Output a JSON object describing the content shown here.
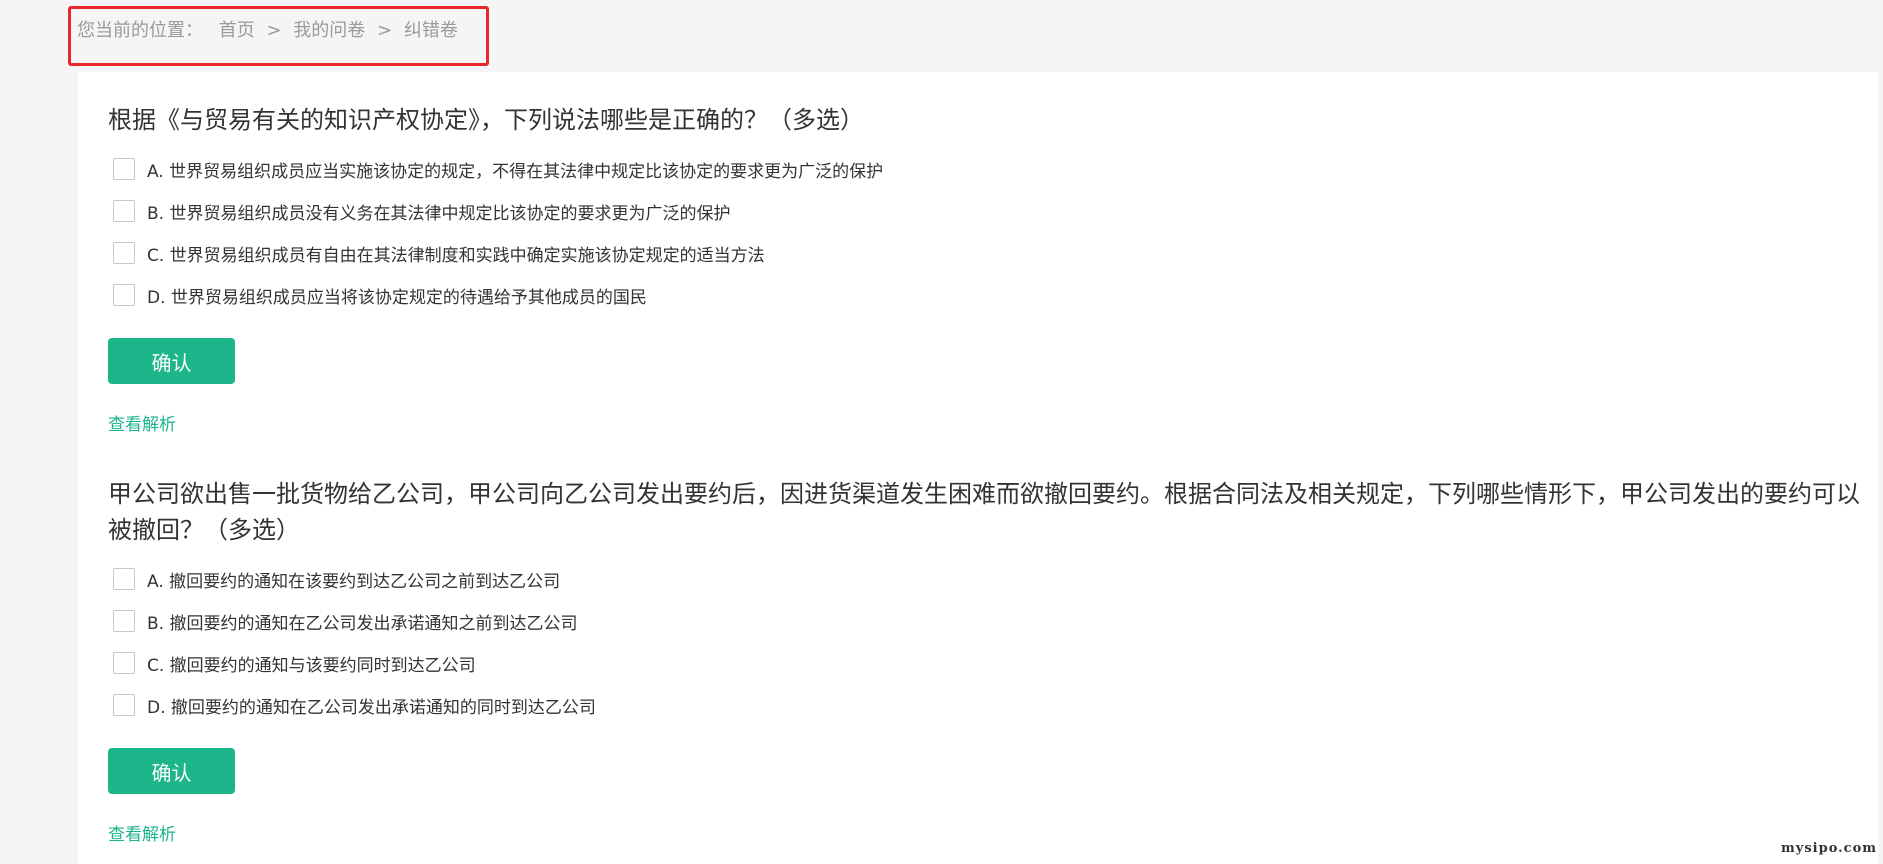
{
  "breadcrumb": {
    "prefix": "您当前的位置：",
    "items": [
      "首页",
      "我的问卷",
      "纠错卷"
    ],
    "separator": ">"
  },
  "questions": [
    {
      "title": "根据《与贸易有关的知识产权协定》，下列说法哪些是正确的？（多选）",
      "options": [
        "A. 世界贸易组织成员应当实施该协定的规定，不得在其法律中规定比该协定的要求更为广泛的保护",
        "B. 世界贸易组织成员没有义务在其法律中规定比该协定的要求更为广泛的保护",
        "C. 世界贸易组织成员有自由在其法律制度和实践中确定实施该协定规定的适当方法",
        "D. 世界贸易组织成员应当将该协定规定的待遇给予其他成员的国民"
      ],
      "confirm_label": "确认",
      "analysis_label": "查看解析"
    },
    {
      "title": "甲公司欲出售一批货物给乙公司，甲公司向乙公司发出要约后，因进货渠道发生困难而欲撤回要约。根据合同法及相关规定，下列哪些情形下，甲公司发出的要约可以被撤回？（多选）",
      "options": [
        "A. 撤回要约的通知在该要约到达乙公司之前到达乙公司",
        "B. 撤回要约的通知在乙公司发出承诺通知之前到达乙公司",
        "C. 撤回要约的通知与该要约同时到达乙公司",
        "D. 撤回要约的通知在乙公司发出承诺通知的同时到达乙公司"
      ],
      "confirm_label": "确认",
      "analysis_label": "查看解析"
    }
  ],
  "watermark": "mysipo.com",
  "colors": {
    "accent": "#1db58a",
    "highlight_border": "#e8262c",
    "text": "#333333",
    "muted": "#9a9a9a"
  }
}
